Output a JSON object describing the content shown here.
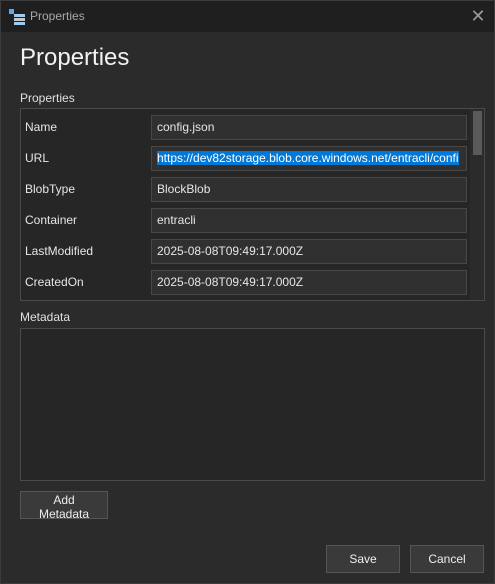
{
  "window": {
    "title": "Properties"
  },
  "header": {
    "title": "Properties"
  },
  "properties_section": {
    "label": "Properties",
    "rows": [
      {
        "name": "Name",
        "value": "config.json"
      },
      {
        "name": "URL",
        "value": "https://dev82storage.blob.core.windows.net/entracli/confi"
      },
      {
        "name": "BlobType",
        "value": "BlockBlob"
      },
      {
        "name": "Container",
        "value": "entracli"
      },
      {
        "name": "LastModified",
        "value": "2025-08-08T09:49:17.000Z"
      },
      {
        "name": "CreatedOn",
        "value": "2025-08-08T09:49:17.000Z"
      }
    ]
  },
  "metadata_section": {
    "label": "Metadata"
  },
  "buttons": {
    "add_metadata": "Add Metadata",
    "save": "Save",
    "cancel": "Cancel"
  },
  "icons": {
    "app": "storage-explorer-icon",
    "close": "close-icon"
  },
  "colors": {
    "selection": "#0078d7",
    "background": "#2b2b2b"
  }
}
